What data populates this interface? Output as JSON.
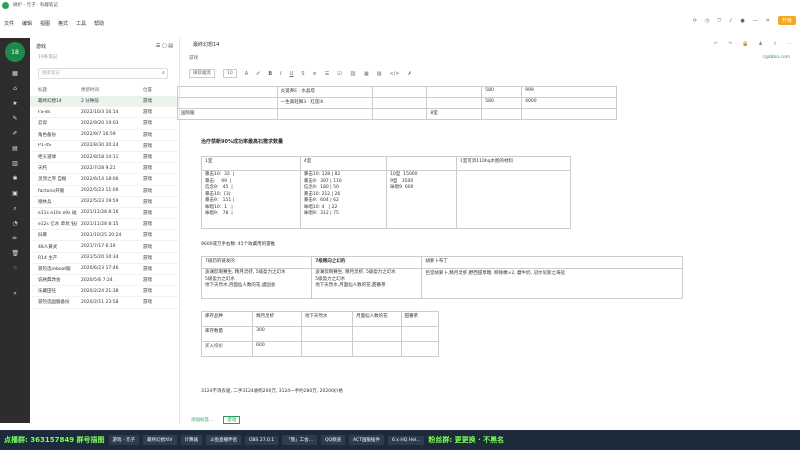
{
  "window": {
    "title_left": "微护 - 元子 · 有趣笔记",
    "menu": [
      "文件",
      "编辑",
      "视图",
      "格式",
      "工具",
      "帮助"
    ]
  },
  "toolbar": {
    "upgrade_label": "升级"
  },
  "nav": {
    "avatar_text": "18"
  },
  "list": {
    "notebook": "游戏",
    "subtitle": "19条笔记",
    "search_placeholder": "搜索笔记",
    "headers": [
      "标题",
      "更新时间",
      "位置"
    ],
    "rows": [
      [
        "最终幻想14",
        "2 分钟前",
        "游戏"
      ],
      [
        "FS-8s",
        "2022/10/3 16:14",
        "游戏"
      ],
      [
        "云母",
        "2022/9/20 19:03",
        "游戏"
      ],
      [
        "角色备份",
        "2022/9/7 16:59",
        "游戏"
      ],
      [
        "P1-4S",
        "2022/8/30 20:24",
        "游戏"
      ],
      [
        "柜头道球",
        "2022/8/18 10:11",
        "游戏"
      ],
      [
        "天朽",
        "2022/7/28 9:21",
        "游戏"
      ],
      [
        "灵顶之序 自掘",
        "2022/6/14 18:06",
        "游戏"
      ],
      [
        "factorio开服",
        "2022/5/23 11:00",
        "游戏"
      ],
      [
        "德林兵",
        "2022/5/23 19:59",
        "游戏"
      ],
      [
        "e11s e10s e9s 碰度仿",
        "2021/11/28 8:16",
        "游戏"
      ],
      [
        "e12s 亿水 草坑 钻石",
        "2021/11/28 8:15",
        "游戏"
      ],
      [
        "旧麻",
        "2021/10/25 20:24",
        "游戏"
      ],
      [
        "48人黄式",
        "2021/7/17 6:16",
        "游戏"
      ],
      [
        "R14 主产",
        "2021/5/20 10:34",
        "游戏"
      ],
      [
        "冒险选reboot服",
        "2020/6/23 17:46",
        "游戏"
      ],
      [
        "说格典改会",
        "2020/5/6 7:24",
        "游戏"
      ],
      [
        "乐藏田任",
        "2020/2/24 21:38",
        "游戏"
      ],
      [
        "冒险选国服备份",
        "2020/2/11 23:58",
        "游戏"
      ]
    ]
  },
  "editor": {
    "title": "最终幻想14",
    "tag": "游戏",
    "link": "cgabbo.com",
    "font_name": "微软雅黑",
    "font_size": "10",
    "table1": [
      [
        "",
        "炎诞养E · 水晶塔",
        "",
        "",
        "580",
        "999"
      ],
      [
        "",
        "一生裁轻舞3 · 红莲lll",
        "",
        "",
        "580",
        "4000"
      ],
      [
        "国际服",
        "",
        "",
        "8室",
        "",
        ""
      ]
    ],
    "heading2": "治疗禁断90%成功率最高石需求数量",
    "t2_head": [
      "1室",
      "4室",
      "",
      "1室可消110hq水图的材料"
    ],
    "t2_col1": "暴击10:  32  |\n暴击:    99  |\n信念9:   45  |\n暴击10:  [3|\n暴击9:   151 |\n咏唱10:  1   |\n咏唱9:   78  |",
    "t2_col2": "暴击10: 128 | 82\n暴击9:  397 | 116\n信念9:  180 | 50\n暴击10: 212 | 26\n暴击9:  604 | 62\n咏唱10: 4   | 22\n咏唱9:  312 | 75",
    "t2_col3": "10型  15000\n9型   3500\n咏唱9  600",
    "line3": "9600或万手右数: 45个收藏用的雷推",
    "t3_head": [
      "7级药的链发的",
      "7级粮向之幻的",
      "胡萝卜布丁"
    ],
    "t3_body": [
      "波澜侃啊赛生, 精月灵虾, 5级盈力之幻水\n5级盈力之幻水\n地下天然水,月面仙人数的花,虞固会",
      "波澜侃啊赛生, 精月灵虾, 5级盈力之幻水\n5级盈力之幻水\n地下天然水,月面仙人数的花,甜番茶",
      "巨堂胡萝卜,精月灵虾,野西甜草糖, 柳钱橡×2, 蘑牛奶, 冠尔尼斯之海盐"
    ],
    "t4": [
      [
        "库存品种",
        "精月灵虾",
        "地下天然水",
        "月面仙人数的花",
        "甜番茶"
      ],
      [
        "库存数量",
        "300",
        "",
        "",
        ""
      ],
      [
        "买入均价",
        "600",
        "",
        "",
        ""
      ]
    ],
    "footer_line": "3124不消农驱, 二手3124收购200万, 3124一手约280万, 20200价格"
  },
  "status": {
    "left": "添加标签...",
    "tag": "游戏"
  },
  "taskbar": {
    "qq_left": "点播群: 363157849 群号描图",
    "items": [
      "游戏 - 元子",
      "最终幻想XIV",
      "计算器",
      "斗鱼直播伴侣",
      "OBS 27.0.1",
      "「我」工会...",
      "QQ频道",
      "ACT国服插件",
      "6.x HQ Hel..."
    ],
    "qq_right": "粉丝群: 更更换 · 不黑名"
  }
}
